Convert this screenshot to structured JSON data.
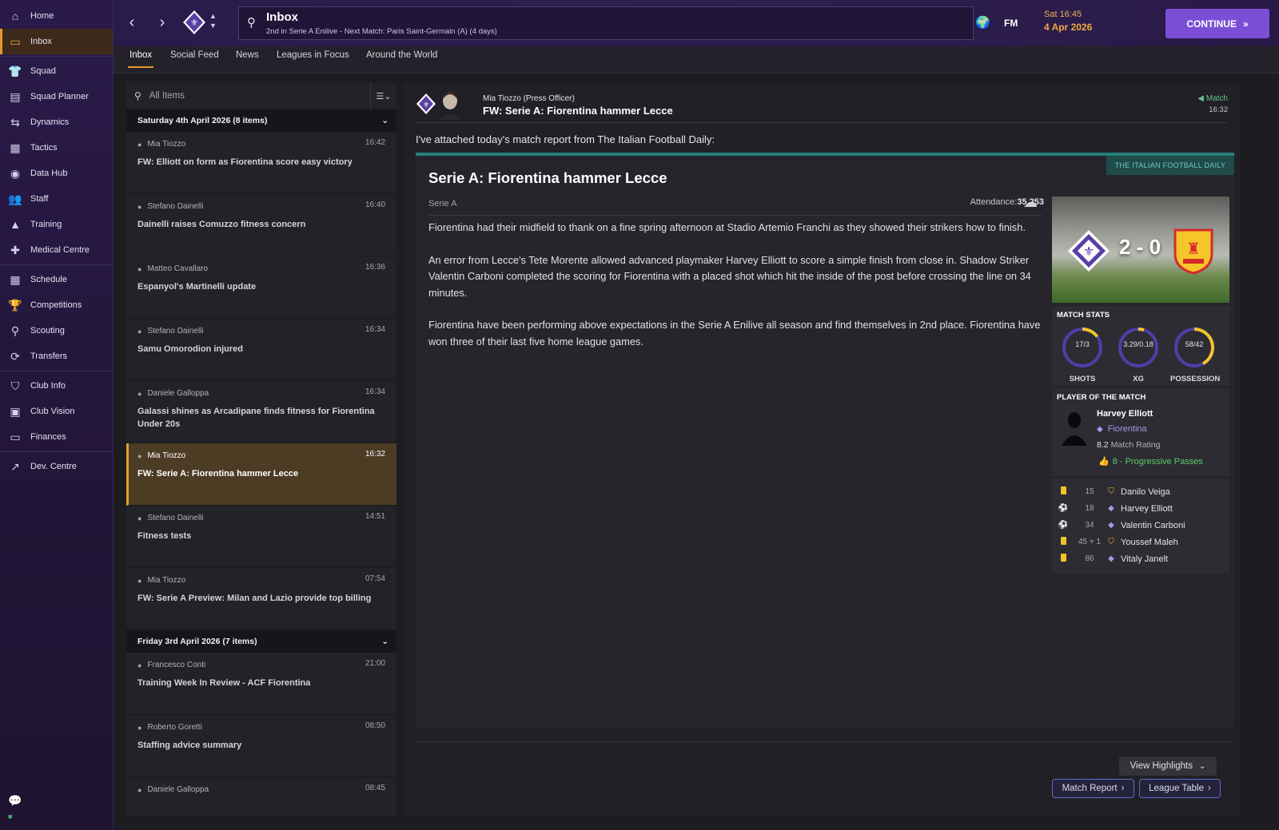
{
  "sidebar": {
    "items": [
      {
        "label": "Home",
        "icon": "home-icon"
      },
      {
        "label": "Inbox",
        "icon": "inbox-icon"
      },
      {
        "label": "Squad",
        "icon": "shirt-icon"
      },
      {
        "label": "Squad Planner",
        "icon": "clipboard-icon"
      },
      {
        "label": "Dynamics",
        "icon": "people-arrows-icon"
      },
      {
        "label": "Tactics",
        "icon": "tactics-board-icon"
      },
      {
        "label": "Data Hub",
        "icon": "chart-circle-icon"
      },
      {
        "label": "Staff",
        "icon": "staff-icon"
      },
      {
        "label": "Training",
        "icon": "cone-icon"
      },
      {
        "label": "Medical Centre",
        "icon": "medical-bag-icon"
      },
      {
        "label": "Schedule",
        "icon": "calendar-icon"
      },
      {
        "label": "Competitions",
        "icon": "trophy-icon"
      },
      {
        "label": "Scouting",
        "icon": "magnifier-icon"
      },
      {
        "label": "Transfers",
        "icon": "swap-icon"
      },
      {
        "label": "Club Info",
        "icon": "shield-icon"
      },
      {
        "label": "Club Vision",
        "icon": "briefcase-icon"
      },
      {
        "label": "Finances",
        "icon": "banknote-icon"
      },
      {
        "label": "Dev. Centre",
        "icon": "growth-icon"
      }
    ]
  },
  "topbar": {
    "title": "Inbox",
    "subtitle": "2nd in Serie A Enilive - Next Match: Paris Saint-Germain (A) (4 days)",
    "fm_label": "FM",
    "time": "Sat 16:45",
    "date": "4 Apr 2026",
    "continue_label": "CONTINUE"
  },
  "tabs": [
    "Inbox",
    "Social Feed",
    "News",
    "Leagues in Focus",
    "Around the World"
  ],
  "list": {
    "search_placeholder": "All Items",
    "groups": [
      {
        "header": "Saturday 4th April 2026 (8 items)",
        "messages": [
          {
            "sender": "Mia Tiozzo",
            "time": "16:42",
            "subject": "FW: Elliott on form as Fiorentina score easy victory"
          },
          {
            "sender": "Stefano Dainelli",
            "time": "16:40",
            "subject": "Dainelli raises Comuzzo fitness concern"
          },
          {
            "sender": "Matteo Cavallaro",
            "time": "16:36",
            "subject": "Espanyol's Martinelli update"
          },
          {
            "sender": "Stefano Dainelli",
            "time": "16:34",
            "subject": "Samu Omorodion injured"
          },
          {
            "sender": "Daniele Galloppa",
            "time": "16:34",
            "subject": "Galassi shines as Arcadipane finds fitness for Fiorentina Under 20s"
          },
          {
            "sender": "Mia Tiozzo",
            "time": "16:32",
            "subject": "FW: Serie A: Fiorentina hammer Lecce"
          },
          {
            "sender": "Stefano Dainelli",
            "time": "14:51",
            "subject": "Fitness tests"
          },
          {
            "sender": "Mia Tiozzo",
            "time": "07:54",
            "subject": "FW: Serie A Preview: Milan and Lazio provide top billing"
          }
        ]
      },
      {
        "header": "Friday 3rd April 2026 (7 items)",
        "messages": [
          {
            "sender": "Francesco Conti",
            "time": "21:00",
            "subject": "Training Week In Review - ACF Fiorentina"
          },
          {
            "sender": "Roberto Goretti",
            "time": "08:50",
            "subject": "Staffing advice summary"
          },
          {
            "sender": "Daniele Galloppa",
            "time": "08:45",
            "subject": ""
          }
        ]
      }
    ]
  },
  "mail": {
    "sender": "Mia Tiozzo  (Press Officer)",
    "subject": "FW: Serie A: Fiorentina hammer Lecce",
    "tag": "Match",
    "time": "16:32",
    "intro": "I've attached today's match report from The Italian Football Daily:",
    "paper": "THE ITALIAN FOOTBALL DAILY",
    "article_title": "Serie A: Fiorentina hammer Lecce",
    "competition": "Serie A",
    "attendance_label": "Attendance:",
    "attendance_value": "35,253",
    "body": [
      "Fiorentina had their midfield to thank on a fine spring afternoon at Stadio Artemio Franchi as they showed their strikers how to finish.",
      "An error from Lecce's Tete Morente allowed advanced playmaker Harvey Elliott to score a simple finish from close in. Shadow Striker Valentin Carboni completed the scoring for Fiorentina with a placed shot which hit the inside of the post before crossing the line on 34 minutes.",
      "Fiorentina have been performing above expectations in the Serie A Enilive all season and find themselves in 2nd place. Fiorentina have won three of their last five home league games."
    ],
    "score": "2 - 0",
    "stats_title": "MATCH STATS",
    "stats": [
      {
        "value": "17/3",
        "label": "SHOTS",
        "fraction": 0.85
      },
      {
        "value": "3.29/0.18",
        "label": "XG",
        "fraction": 0.95
      },
      {
        "value": "58/42",
        "label": "POSSESSION",
        "fraction": 0.58
      }
    ],
    "potm_title": "PLAYER OF THE MATCH",
    "potm_name": "Harvey Elliott",
    "potm_team": "Fiorentina",
    "potm_rating": "8.2",
    "potm_rating_label": "Match Rating",
    "potm_stat": "8 - Progressive Passes",
    "events": [
      {
        "type": "yellow-card",
        "minute": "15",
        "team": "Lecce",
        "player": "Danilo Veiga"
      },
      {
        "type": "goal",
        "minute": "18",
        "team": "Fiorentina",
        "player": "Harvey Elliott"
      },
      {
        "type": "goal",
        "minute": "34",
        "team": "Fiorentina",
        "player": "Valentin Carboni"
      },
      {
        "type": "yellow-card",
        "minute": "45 + 1",
        "team": "Lecce",
        "player": "Youssef Maleh"
      },
      {
        "type": "yellow-card",
        "minute": "86",
        "team": "Fiorentina",
        "player": "Vitaly Janelt"
      }
    ],
    "view_highlights": "View Highlights",
    "match_report": "Match Report",
    "league_table": "League Table"
  },
  "colors": {
    "accent_orange": "#e59a2a",
    "continue_purple": "#7a4fd6",
    "fiorentina_purple": "#5a3ea6",
    "lecce_red": "#d42a2a",
    "lecce_yellow": "#f5c52a",
    "match_green": "#62c38a"
  }
}
